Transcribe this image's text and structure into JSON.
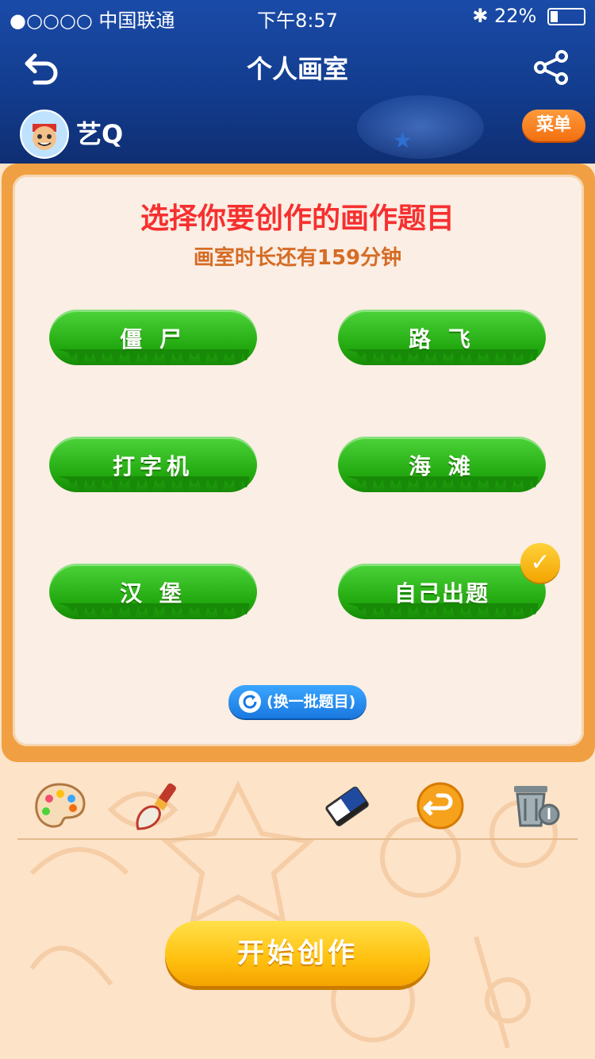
{
  "status_bar": {
    "carrier": "●○○○○ 中国联通",
    "time": "下午8:57",
    "battery": "22%",
    "battery_level": 0.22
  },
  "header": {
    "title": "个人画室",
    "back_icon": "back-arrow-icon",
    "share_icon": "share-icon",
    "username": "艺Q",
    "menu_label": "菜单"
  },
  "board": {
    "title": "选择你要创作的画作题目",
    "subtitle": "画室时长还有159分钟",
    "topics": [
      {
        "label": "僵 尸",
        "selected": false
      },
      {
        "label": "路 飞",
        "selected": false
      },
      {
        "label": "打字机",
        "selected": false
      },
      {
        "label": "海 滩",
        "selected": false
      },
      {
        "label": "汉 堡",
        "selected": false
      },
      {
        "label": "自己出题",
        "selected": true
      }
    ],
    "refresh_label": "(换一批题目)"
  },
  "tools": [
    {
      "name": "palette-icon"
    },
    {
      "name": "brush-icon"
    },
    {
      "name": "eraser-icon"
    },
    {
      "name": "undo-icon"
    },
    {
      "name": "trash-icon"
    }
  ],
  "start_label": "开始创作",
  "colors": {
    "title_red": "#f63030",
    "subtitle_orange": "#d56c26",
    "topic_green": "#22a80f",
    "header_blue": "#123b8c",
    "start_yellow": "#ffc00f"
  }
}
